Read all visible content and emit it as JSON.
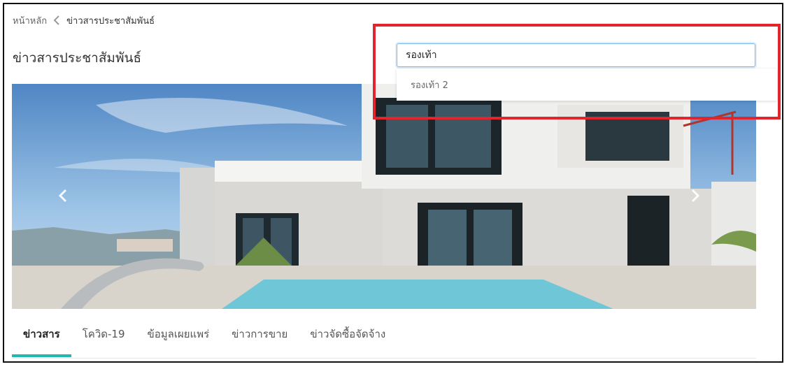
{
  "breadcrumb": {
    "home": "หน้าหลัก",
    "current": "ข่าวสารประชาสัมพันธ์"
  },
  "page": {
    "title": "ข่าวสารประชาสัมพันธ์"
  },
  "search": {
    "value": "รองเท้า",
    "suggestions": [
      "รองเท้า 2"
    ]
  },
  "carousel": {
    "prev_icon": "chevron-left-icon",
    "next_icon": "chevron-right-icon"
  },
  "tabs": [
    {
      "label": "ข่าวสาร",
      "active": true
    },
    {
      "label": "โควิด-19",
      "active": false
    },
    {
      "label": "ข้อมูลเผยแพร่",
      "active": false
    },
    {
      "label": "ข่าวการขาย",
      "active": false
    },
    {
      "label": "ข่าวจัดซื้อจัดจ้าง",
      "active": false
    }
  ],
  "colors": {
    "accent": "#1eb9b0",
    "highlight": "#e0252d",
    "input_focus": "#7db6e8"
  }
}
